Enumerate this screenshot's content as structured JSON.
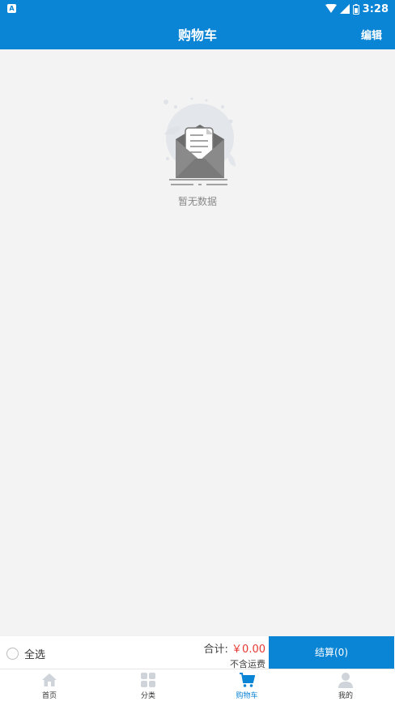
{
  "status_bar": {
    "time": "3:28",
    "app_indicator": "A"
  },
  "header": {
    "title": "购物车",
    "edit_label": "编辑"
  },
  "empty_state": {
    "message": "暂无数据",
    "icon": "empty-envelope-icon"
  },
  "checkout": {
    "select_all_label": "全选",
    "total_label": "合计:",
    "total_amount": "￥0.00",
    "shipping_note": "不含运费",
    "checkout_button": "结算(0)"
  },
  "tabs": [
    {
      "label": "首页",
      "icon": "home-icon",
      "active": false
    },
    {
      "label": "分类",
      "icon": "category-grid-icon",
      "active": false
    },
    {
      "label": "购物车",
      "icon": "cart-icon",
      "active": true
    },
    {
      "label": "我的",
      "icon": "user-icon",
      "active": false
    }
  ],
  "colors": {
    "primary": "#0a84d4",
    "price": "#e53935",
    "background": "#f3f3f3"
  }
}
